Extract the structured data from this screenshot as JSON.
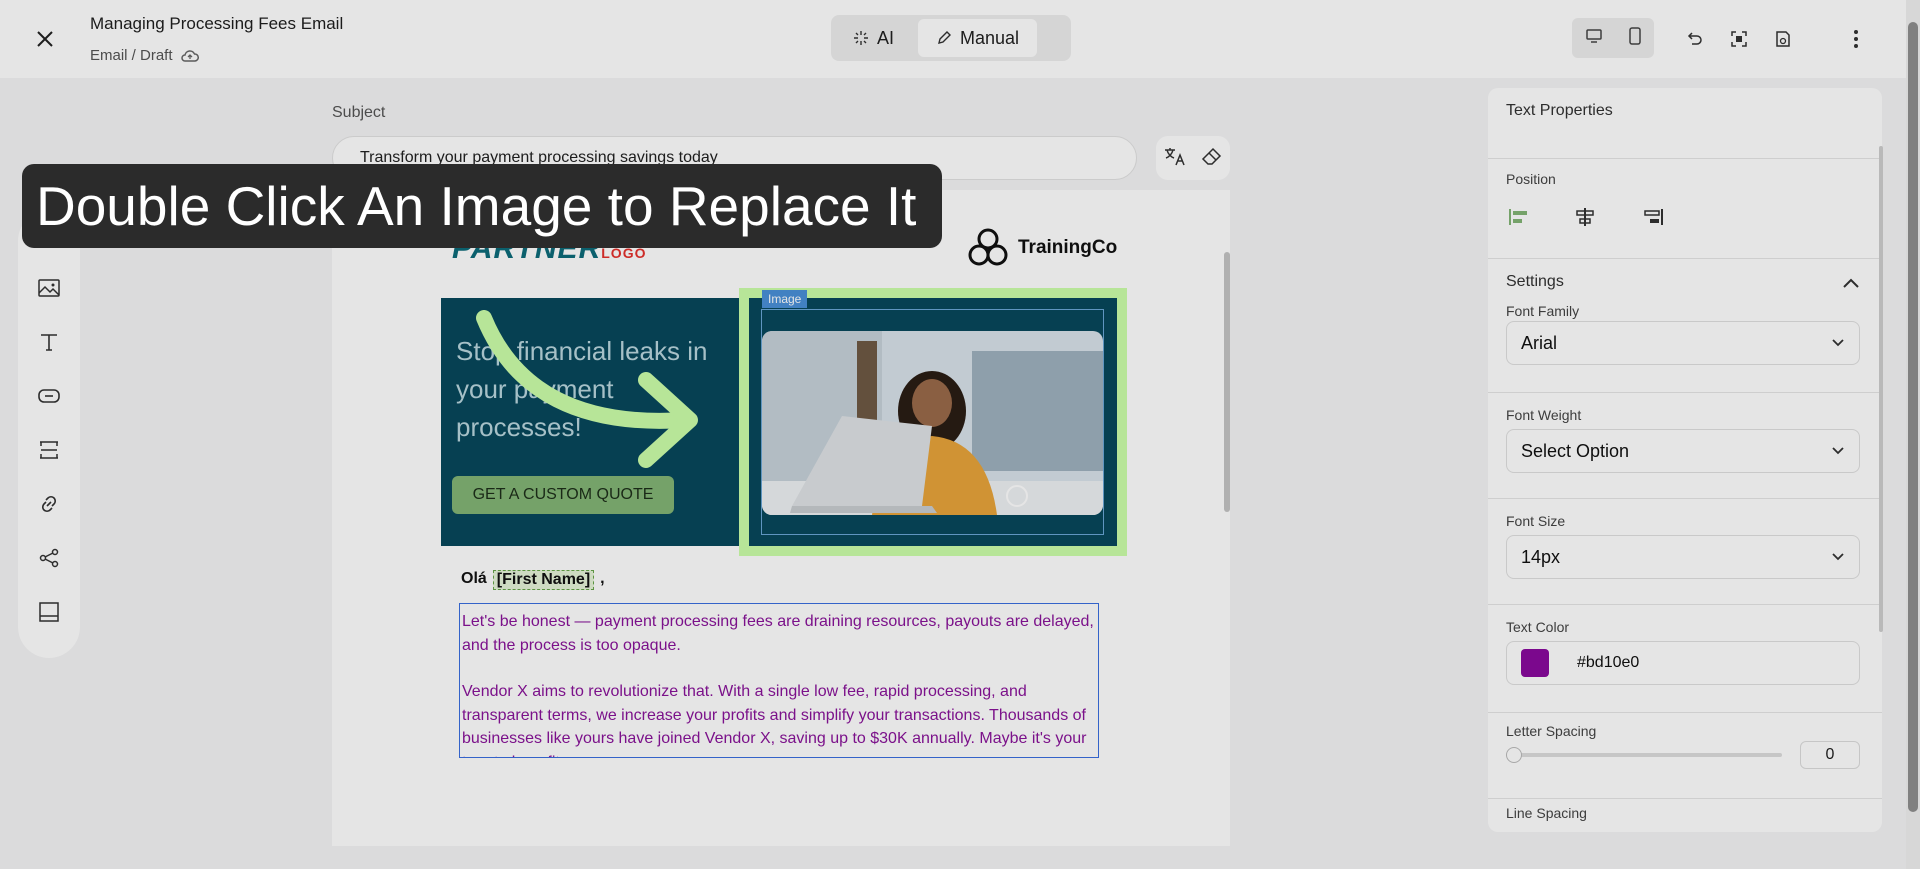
{
  "header": {
    "title": "Managing Processing Fees Email",
    "breadcrumb": "Email / Draft",
    "modes": [
      {
        "label": "AI",
        "icon": "sparkle-icon"
      },
      {
        "label": "Manual",
        "icon": "pencil-icon"
      }
    ],
    "active_mode": "Manual",
    "device_options": [
      "desktop-icon",
      "mobile-icon"
    ],
    "actions": [
      "undo-icon",
      "fit-screen-icon",
      "save-draft-icon",
      "more-icon"
    ]
  },
  "subject": {
    "label": "Subject",
    "value": "Transform your payment processing savings today"
  },
  "left_toolbar": [
    "table-icon",
    "image-icon",
    "text-icon",
    "button-icon",
    "spacer-icon",
    "link-icon",
    "share-icon",
    "footer-icon"
  ],
  "email": {
    "partner_logo": "PARTNER",
    "partner_logo_small": "LOGO",
    "brand_name": "TrainingCo",
    "hero_text": "Stop financial leaks in your payment processes!",
    "cta_label": "GET A CUSTOM QUOTE",
    "image_tag": "Image",
    "greeting_prefix": "Olá",
    "merge_tag": "[First Name]",
    "greeting_suffix": ",",
    "paragraphs": [
      "Let's be honest — payment processing fees are draining resources, payouts are delayed, and the process is too opaque.",
      "Vendor X aims to revolutionize that. With a single low fee, rapid processing, and transparent terms, we increase your profits and simplify your transactions. Thousands of businesses like yours have joined Vendor X, saving up to $30K annually. Maybe it's your turn to benefit."
    ]
  },
  "properties": {
    "title": "Text Properties",
    "position_label": "Position",
    "settings_label": "Settings",
    "font_family_label": "Font Family",
    "font_family_value": "Arial",
    "font_weight_label": "Font Weight",
    "font_weight_value": "Select Option",
    "font_size_label": "Font Size",
    "font_size_value": "14px",
    "text_color_label": "Text Color",
    "text_color_value": "#bd10e0",
    "letter_spacing_label": "Letter Spacing",
    "letter_spacing_value": "0",
    "line_spacing_label": "Line Spacing"
  },
  "tooltip": {
    "text": "Double Click An Image to Replace It"
  },
  "colors": {
    "hero_bg": "#07485c",
    "cta_bg": "#83b575",
    "highlight": "#ccffaa",
    "swatch": "#8a0a9e",
    "body_text": "#8a149a"
  }
}
